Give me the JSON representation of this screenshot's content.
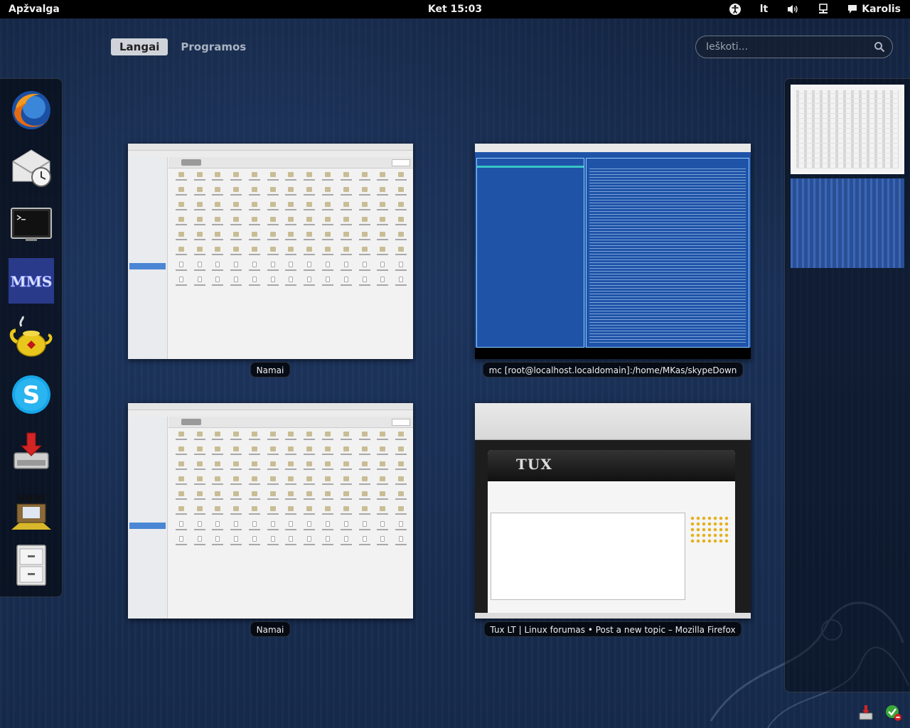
{
  "panel": {
    "activities": "Apžvalga",
    "clock": "Ket 15:03",
    "keyboard_layout": "lt",
    "user_name": "Karolis",
    "icons": [
      "accessibility-icon",
      "volume-icon",
      "network-icon",
      "chat-icon"
    ]
  },
  "view_tabs": [
    {
      "label": "Langai",
      "active": true
    },
    {
      "label": "Programos",
      "active": false
    }
  ],
  "search": {
    "placeholder": "Ieškoti..."
  },
  "dash": [
    {
      "name": "firefox-icon"
    },
    {
      "name": "evolution-mail-icon"
    },
    {
      "name": "terminal-icon"
    },
    {
      "name": "mms-icon"
    },
    {
      "name": "teapot-icon"
    },
    {
      "name": "skype-icon"
    },
    {
      "name": "installer-icon"
    },
    {
      "name": "yumex-icon"
    },
    {
      "name": "file-cabinet-icon"
    }
  ],
  "windows": [
    {
      "title": "Namai"
    },
    {
      "title": "mc [root@localhost.localdomain]:/home/MKas/skypeDown"
    },
    {
      "title": "Namai"
    },
    {
      "title": "Tux LT | Linux forumas • Post a new topic – Mozilla Firefox"
    }
  ],
  "firefox_page": {
    "logo": "TUX"
  },
  "workspaces": [
    "workspace-1",
    "workspace-2"
  ]
}
